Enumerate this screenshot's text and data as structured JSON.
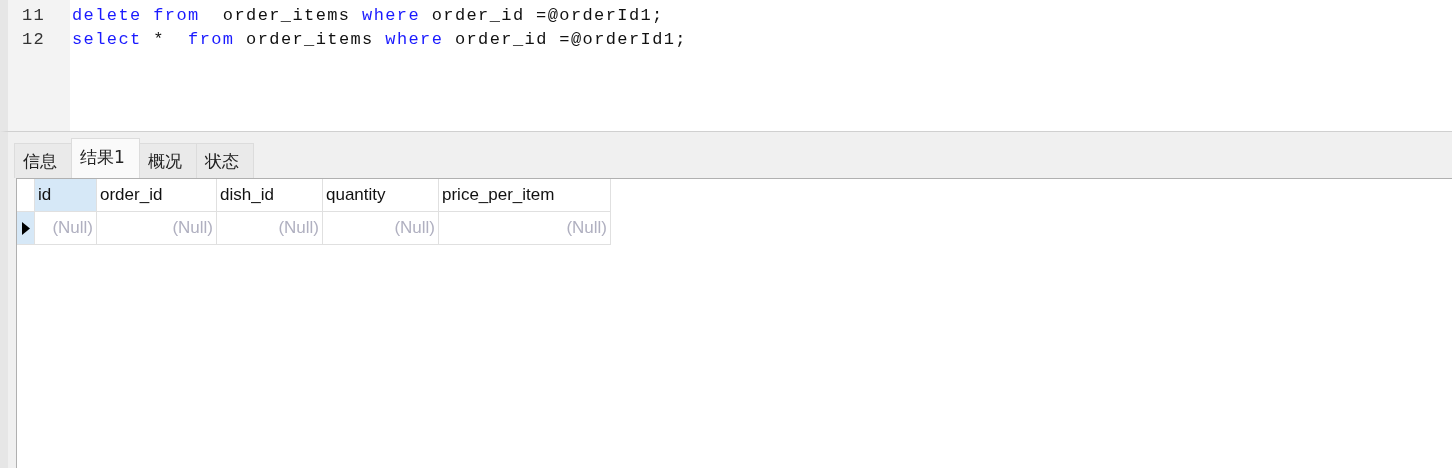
{
  "editor": {
    "lines": [
      {
        "number": "11",
        "tokens": [
          {
            "kind": "keyword",
            "text": "delete from"
          },
          {
            "kind": "plain",
            "text": "  order_items "
          },
          {
            "kind": "keyword",
            "text": "where"
          },
          {
            "kind": "plain",
            "text": " order_id =@orderId1;"
          }
        ]
      },
      {
        "number": "12",
        "tokens": [
          {
            "kind": "keyword",
            "text": "select"
          },
          {
            "kind": "plain",
            "text": " *  "
          },
          {
            "kind": "keyword",
            "text": "from"
          },
          {
            "kind": "plain",
            "text": " order_items "
          },
          {
            "kind": "keyword",
            "text": "where"
          },
          {
            "kind": "plain",
            "text": " order_id =@orderId1;"
          }
        ]
      }
    ]
  },
  "tabs": [
    {
      "label": "信息",
      "selected": false
    },
    {
      "label": "结果1",
      "selected": true
    },
    {
      "label": "概况",
      "selected": false
    },
    {
      "label": "状态",
      "selected": false
    }
  ],
  "table": {
    "columns": [
      {
        "label": "id",
        "selected": true
      },
      {
        "label": "order_id",
        "selected": false
      },
      {
        "label": "dish_id",
        "selected": false
      },
      {
        "label": "quantity",
        "selected": false
      },
      {
        "label": "price_per_item",
        "selected": false
      }
    ],
    "rows": [
      {
        "selected": true,
        "cells": [
          "(Null)",
          "(Null)",
          "(Null)",
          "(Null)",
          "(Null)"
        ]
      }
    ]
  }
}
